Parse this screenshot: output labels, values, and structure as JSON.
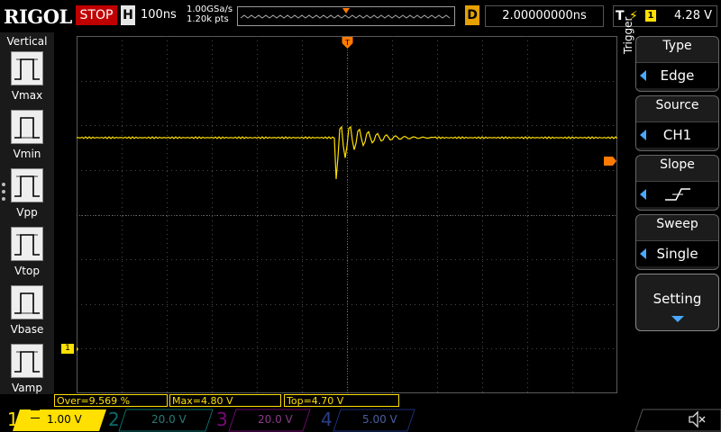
{
  "header": {
    "brand": "RIGOL",
    "run_state": "STOP",
    "horizontal_label": "H",
    "timebase": "100ns",
    "sample_rate": "1.00GSa/s",
    "memory_points": "1.20k pts",
    "delay_label": "D",
    "delay_value": "2.00000000ns",
    "trigger_label": "T",
    "trigger_source_badge": "1",
    "trigger_level": "4.28 V"
  },
  "left_menu": {
    "title": "Vertical",
    "items": [
      {
        "label": "Vmax",
        "icon": "vmax-waveform-icon"
      },
      {
        "label": "Vmin",
        "icon": "vmin-waveform-icon"
      },
      {
        "label": "Vpp",
        "icon": "vpp-waveform-icon"
      },
      {
        "label": "Vtop",
        "icon": "vtop-waveform-icon"
      },
      {
        "label": "Vbase",
        "icon": "vbase-waveform-icon"
      },
      {
        "label": "Vamp",
        "icon": "vamp-waveform-icon"
      }
    ]
  },
  "right_menu": {
    "title": "Trigger",
    "type": {
      "label": "Type",
      "value": "Edge"
    },
    "source": {
      "label": "Source",
      "value": "CH1"
    },
    "slope": {
      "label": "Slope"
    },
    "sweep": {
      "label": "Sweep",
      "value": "Single"
    },
    "setting": {
      "label": "Setting"
    }
  },
  "measurements": {
    "overshoot": "Over=9.569 %",
    "max": "Max=4.80 V",
    "top": "Top=4.70 V"
  },
  "channels": [
    {
      "number": "1",
      "scale": "1.00 V",
      "color": "#ffe000",
      "active": true
    },
    {
      "number": "2",
      "scale": "20.0 V",
      "color": "#00c8c8",
      "active": false
    },
    {
      "number": "3",
      "scale": "20.0 V",
      "color": "#c800c8",
      "active": false
    },
    {
      "number": "4",
      "scale": "5.00 V",
      "color": "#2f6fff",
      "active": false
    }
  ],
  "markers": {
    "ch1_ground_badge": "1",
    "trigger_position_badge": "T"
  },
  "colors": {
    "ch1": "#ffe000",
    "trigger_marker": "#ff7a00",
    "stop": "#c00000",
    "menu_arrow": "#4aa8ff"
  }
}
